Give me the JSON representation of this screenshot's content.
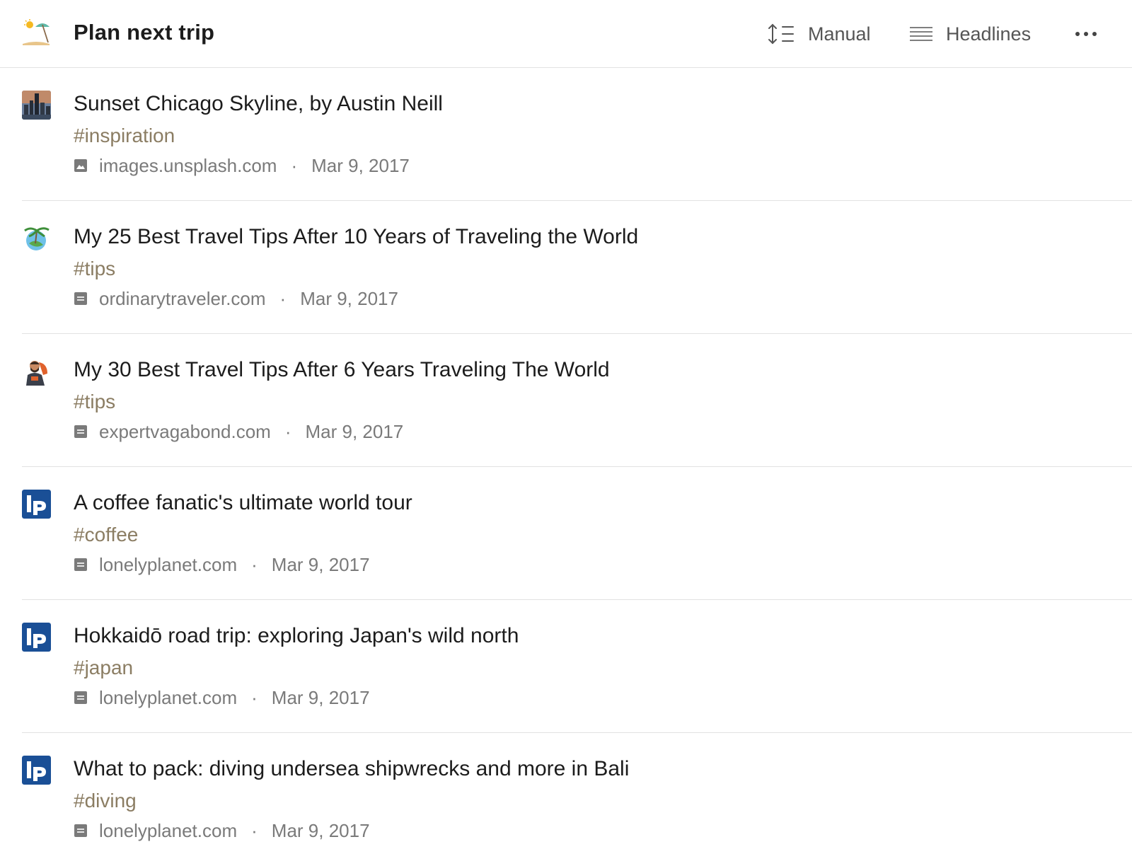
{
  "header": {
    "title": "Plan next trip",
    "icon": "beach-umbrella-icon",
    "sort_label": "Manual",
    "view_label": "Headlines",
    "more_icon": "ellipsis-icon"
  },
  "items": [
    {
      "title": "Sunset Chicago Skyline, by Austin Neill",
      "tag": "#inspiration",
      "source": "images.unsplash.com",
      "source_type": "image-icon",
      "date": "Mar 9, 2017",
      "thumb": "city-skyline-thumbnail"
    },
    {
      "title": "My 25 Best Travel Tips After 10 Years of Traveling the World",
      "tag": "#tips",
      "source": "ordinarytraveler.com",
      "source_type": "article-icon",
      "date": "Mar 9, 2017",
      "thumb": "palm-globe-logo"
    },
    {
      "title": "My 30 Best Travel Tips After 6 Years Traveling The World",
      "tag": "#tips",
      "source": "expertvagabond.com",
      "source_type": "article-icon",
      "date": "Mar 9, 2017",
      "thumb": "traveler-avatar"
    },
    {
      "title": "A coffee fanatic's ultimate world tour",
      "tag": "#coffee",
      "source": "lonelyplanet.com",
      "source_type": "article-icon",
      "date": "Mar 9, 2017",
      "thumb": "lonely-planet-logo"
    },
    {
      "title": "Hokkaidō road trip: exploring Japan's wild north",
      "tag": "#japan",
      "source": "lonelyplanet.com",
      "source_type": "article-icon",
      "date": "Mar 9, 2017",
      "thumb": "lonely-planet-logo"
    },
    {
      "title": "What to pack: diving undersea shipwrecks and more in Bali",
      "tag": "#diving",
      "source": "lonelyplanet.com",
      "source_type": "article-icon",
      "date": "Mar 9, 2017",
      "thumb": "lonely-planet-logo"
    }
  ],
  "meta_separator": "·",
  "colors": {
    "tag": "#8b7d63",
    "meta": "#7a7a7a",
    "title": "#1c1c1c",
    "divider": "#e2e2e2",
    "lonely_planet_blue": "#1a4f96"
  }
}
